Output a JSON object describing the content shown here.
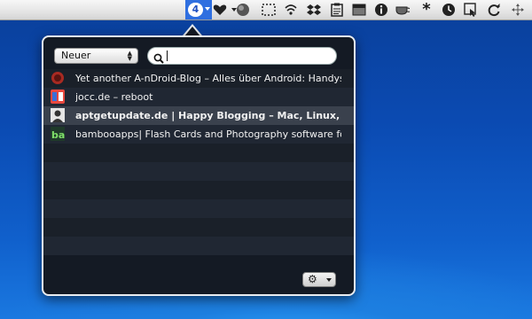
{
  "menubar": {
    "badge_count": "4",
    "icons": [
      "heart-icon",
      "globe-icon",
      "selection-icon",
      "wifi-icon",
      "dropbox-icon",
      "clipboard-icon",
      "window-icon",
      "info-icon",
      "cup-icon",
      "asterisk-icon",
      "clock-icon",
      "cursor-icon",
      "sync-icon",
      "move-icon"
    ]
  },
  "popover": {
    "sort_select": "Neuer",
    "search": {
      "value": "",
      "placeholder": ""
    },
    "items": [
      {
        "title": "Yet another A-nDroid-Blog – Alles über Android: Handys,",
        "favicon_color": "#c0392b"
      },
      {
        "title": "jocc.de – reboot",
        "favicon_color": "#e8483e"
      },
      {
        "title": "aptgetupdate.de | Happy Blogging – Mac, Linux, Technik,",
        "favicon_color": "#e6e6e6"
      },
      {
        "title": "bambooapps| Flash Cards and Photography software for",
        "favicon_color": "#1f6f3f"
      }
    ],
    "selected_index": 2
  },
  "colors": {
    "menubar_highlight": "#2f6fe0",
    "popover_bg": "#141a24"
  }
}
